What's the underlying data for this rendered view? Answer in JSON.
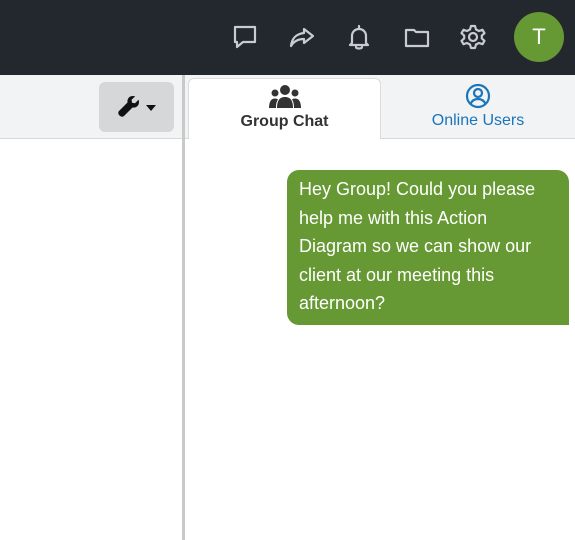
{
  "header": {
    "icons": [
      "chat-bubble-icon",
      "share-icon",
      "bell-icon",
      "folder-icon",
      "gear-icon"
    ],
    "avatar_initial": "T",
    "avatar_color": "#669933",
    "background": "#23272e"
  },
  "left_toolbar": {
    "tools_icon": "wrench-icon",
    "dropdown_icon": "caret-down-icon"
  },
  "tabs": [
    {
      "label": "Group Chat",
      "icon": "users-icon",
      "active": true
    },
    {
      "label": "Online Users",
      "icon": "user-circle-icon",
      "active": false
    }
  ],
  "chat": {
    "messages": [
      {
        "text": "Hey Group! Could you please help me with this Action Diagram so we can show our client at our meeting this afternoon?",
        "own": true,
        "color": "#669933"
      }
    ]
  },
  "colors": {
    "accent_green": "#669933",
    "link_blue": "#1a75bb",
    "topbar": "#23272e"
  }
}
